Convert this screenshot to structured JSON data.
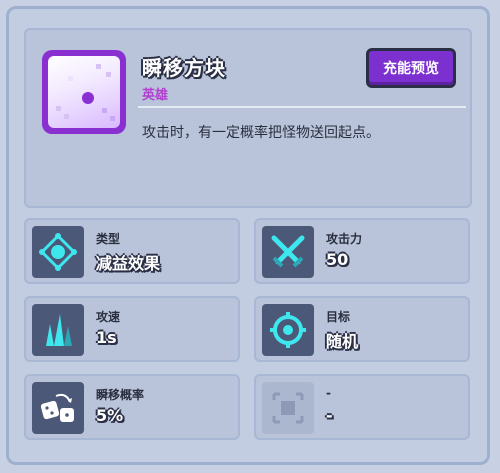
{
  "skill": {
    "title": "瞬移方块",
    "rarity": "英雄",
    "description": "攻击时，有一定概率把怪物送回起点。",
    "preview_button": "充能预览"
  },
  "stats": [
    {
      "label": "类型",
      "value": "减益效果",
      "icon": "debuff-diamond-icon"
    },
    {
      "label": "攻击力",
      "value": "50",
      "icon": "crossed-swords-icon"
    },
    {
      "label": "攻速",
      "value": "1s",
      "icon": "crystal-spikes-icon"
    },
    {
      "label": "目标",
      "value": "随机",
      "icon": "crosshair-target-icon"
    },
    {
      "label": "瞬移概率",
      "value": "5%",
      "icon": "dice-swap-icon"
    },
    {
      "label": "-",
      "value": "-",
      "icon": "empty-slot-icon"
    }
  ],
  "colors": {
    "accent_purple": "#7b30cf",
    "rarity_hero": "#b23fcf",
    "panel_bg": "#c3cde1",
    "icon_cyan": "#3ee6ee"
  }
}
